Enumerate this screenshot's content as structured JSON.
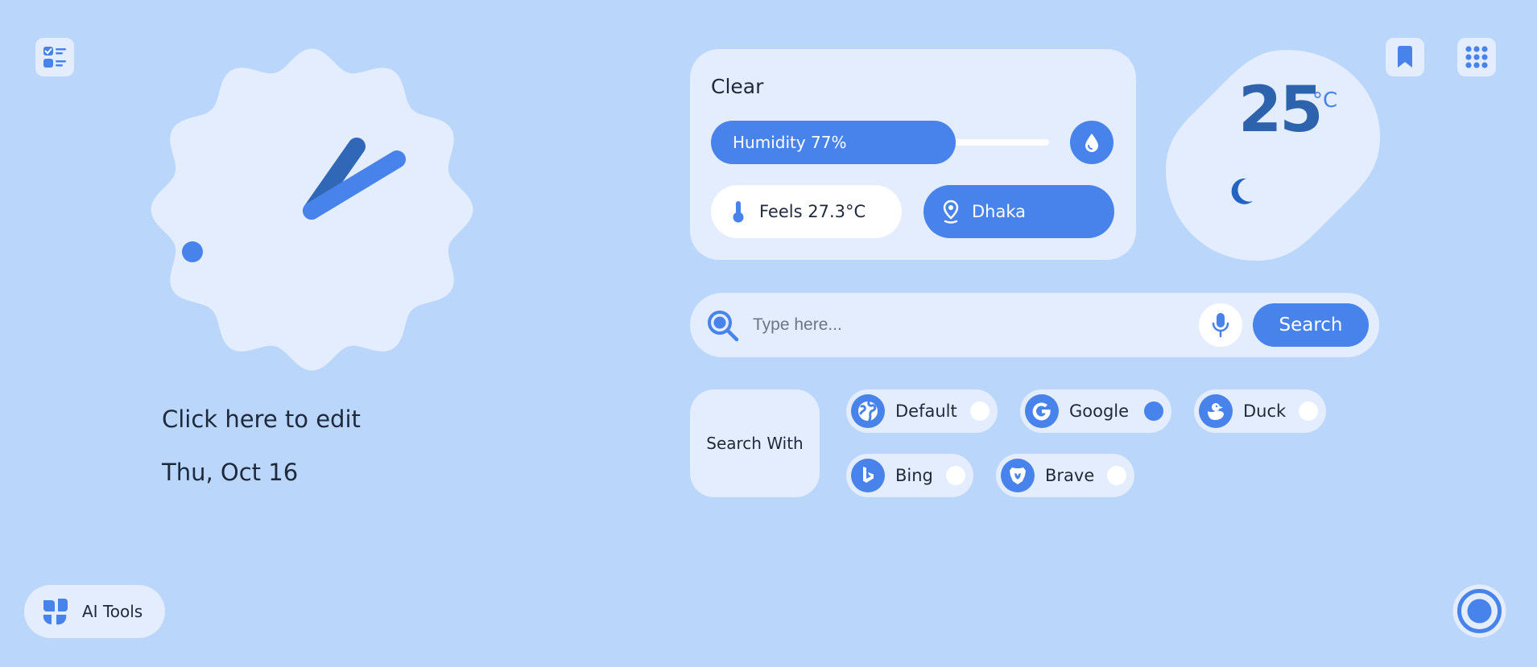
{
  "colors": {
    "background": "#bad6fb",
    "card": "#e3edfd",
    "accent": "#4783ea",
    "accent_dark": "#2d63ad",
    "text": "#1e2a3b"
  },
  "top_left": {
    "icon": "tasks-icon"
  },
  "top_right": {
    "bookmark_icon": "bookmark-icon",
    "apps_icon": "apps-grid-icon"
  },
  "clock": {
    "edit_label": "Click here to edit",
    "date": "Thu, Oct 16"
  },
  "weather": {
    "condition": "Clear",
    "humidity_label": "Humidity 77%",
    "humidity_percent": 77,
    "feels_like": "Feels 27.3°C",
    "city": "Dhaka",
    "temperature": "25",
    "temperature_unit": "°C",
    "icons": {
      "humidity": "water-drop-icon",
      "feels": "thermometer-icon",
      "city": "location-pin-icon",
      "condition": "moon-icon"
    }
  },
  "search": {
    "placeholder": "Type here...",
    "value": "",
    "button_label": "Search",
    "icons": {
      "search": "search-icon",
      "mic": "microphone-icon"
    }
  },
  "search_with": {
    "label": "Search With",
    "engines": [
      {
        "name": "Default",
        "icon": "globe-icon",
        "selected": false
      },
      {
        "name": "Google",
        "icon": "google-icon",
        "selected": true
      },
      {
        "name": "Duck",
        "icon": "duck-icon",
        "selected": false
      },
      {
        "name": "Bing",
        "icon": "bing-icon",
        "selected": false
      },
      {
        "name": "Brave",
        "icon": "brave-icon",
        "selected": false
      }
    ]
  },
  "ai_tools": {
    "label": "AI Tools",
    "icon": "ai-tools-icon"
  },
  "assistant": {
    "icon": "assistant-ring-icon"
  }
}
